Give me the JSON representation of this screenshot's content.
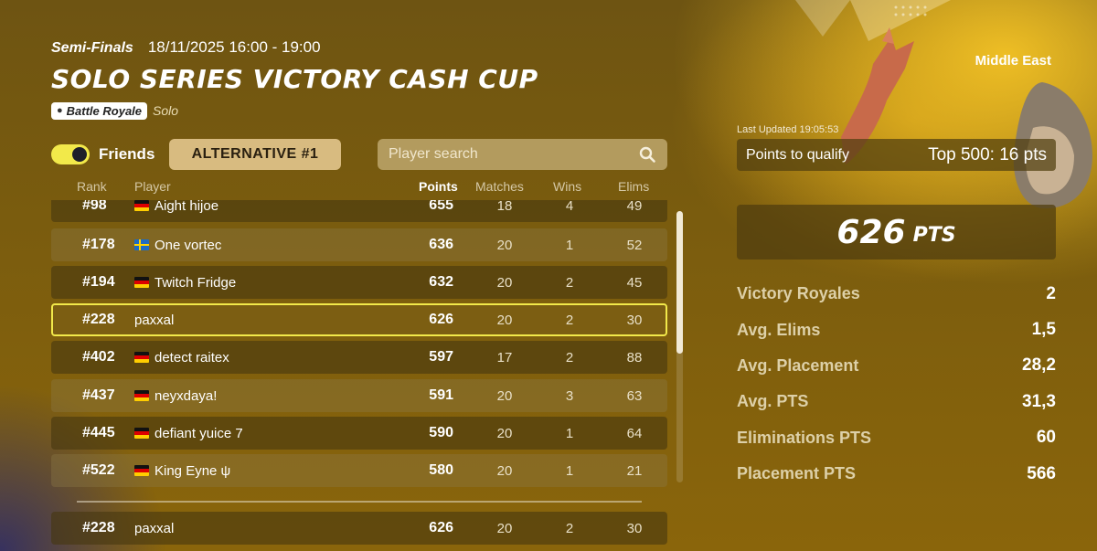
{
  "header": {
    "stage": "Semi-Finals",
    "datetime": "18/11/2025 16:00 - 19:00",
    "title": "SOLO SERIES VICTORY CASH CUP",
    "mode_tag": "Battle Royale",
    "team_mode": "Solo"
  },
  "controls": {
    "friends_label": "Friends",
    "friends_toggle_on": true,
    "alternative_label": "ALTERNATIVE #1",
    "search_placeholder": "Player search"
  },
  "table": {
    "columns": [
      "Rank",
      "Player",
      "Points",
      "Matches",
      "Wins",
      "Elims"
    ],
    "rows": [
      {
        "rank": "#98",
        "flag": "de",
        "player": "Aight hijoe",
        "points": "655",
        "matches": "18",
        "wins": "4",
        "elims": "49"
      },
      {
        "rank": "#178",
        "flag": "se",
        "player": "One vortec",
        "points": "636",
        "matches": "20",
        "wins": "1",
        "elims": "52"
      },
      {
        "rank": "#194",
        "flag": "de",
        "player": "Twitch Fridge",
        "points": "632",
        "matches": "20",
        "wins": "2",
        "elims": "45"
      },
      {
        "rank": "#228",
        "flag": "",
        "player": "paxxal",
        "points": "626",
        "matches": "20",
        "wins": "2",
        "elims": "30",
        "highlighted": true
      },
      {
        "rank": "#402",
        "flag": "de",
        "player": "detect raitex",
        "points": "597",
        "matches": "17",
        "wins": "2",
        "elims": "88"
      },
      {
        "rank": "#437",
        "flag": "de",
        "player": "neyxdaya!",
        "points": "591",
        "matches": "20",
        "wins": "3",
        "elims": "63"
      },
      {
        "rank": "#445",
        "flag": "de",
        "player": "defiant yuice 7",
        "points": "590",
        "matches": "20",
        "wins": "1",
        "elims": "64"
      },
      {
        "rank": "#522",
        "flag": "de",
        "player": "King Eyne ψ",
        "points": "580",
        "matches": "20",
        "wins": "1",
        "elims": "21"
      }
    ],
    "self_row": {
      "rank": "#228",
      "player": "paxxal",
      "points": "626",
      "matches": "20",
      "wins": "2",
      "elims": "30"
    }
  },
  "side": {
    "region": "Middle East",
    "last_updated": "Last Updated 19:05:53",
    "qualify_label": "Points to qualify",
    "qualify_value": "Top 500: 16 pts",
    "points_number": "626",
    "points_unit": "PTS",
    "stats": [
      {
        "label": "Victory Royales",
        "value": "2"
      },
      {
        "label": "Avg. Elims",
        "value": "1,5"
      },
      {
        "label": "Avg. Placement",
        "value": "28,2"
      },
      {
        "label": "Avg. PTS",
        "value": "31,3"
      },
      {
        "label": "Eliminations PTS",
        "value": "60"
      },
      {
        "label": "Placement PTS",
        "value": "566"
      }
    ]
  },
  "colors": {
    "accent_yellow": "#f2e94a",
    "alt_button_bg": "#d8bb80"
  },
  "icons": {
    "search": "search-icon",
    "mode": "money-bag-icon"
  }
}
